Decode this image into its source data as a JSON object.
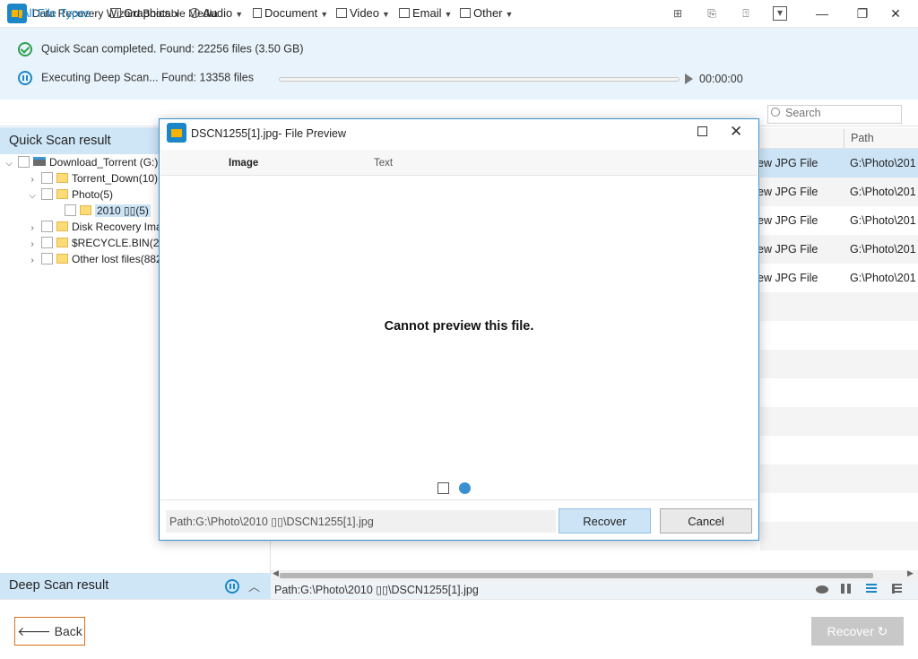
{
  "window": {
    "title": "Data Recovery Wizard Bootable Media",
    "min": "—",
    "max": "❐",
    "close": "✕",
    "icons": [
      "⊞",
      "⎘",
      "⍐",
      "▾"
    ]
  },
  "status": {
    "quick_scan": "Quick Scan completed.  Found: 22256 files (3.50 GB)",
    "deep_scan": "Executing Deep Scan... Found: 13358 files",
    "progress": 0.0,
    "timer": "00:00:00"
  },
  "filters": [
    {
      "label": "All File Types"
    },
    {
      "label": "Graphics"
    },
    {
      "label": "Audio"
    },
    {
      "label": "Document"
    },
    {
      "label": "Video"
    },
    {
      "label": "Email"
    },
    {
      "label": "Other"
    }
  ],
  "search": {
    "placeholder": "Search"
  },
  "left_panel": {
    "quick_title": "Quick Scan result",
    "tree": {
      "root": "Download_Torrent (G:)(",
      "torrent": "Torrent_Down(10)",
      "photo": "Photo(5)",
      "photo_2010": "2010 ▯▯(5)",
      "disk": "Disk Recovery Ima",
      "recycle": "$RECYCLE.BIN(20)",
      "other": "Other lost files(882"
    },
    "deep_title": "Deep Scan result"
  },
  "table": {
    "col_path": "Path",
    "rows": [
      {
        "type": "ew JPG File",
        "path": "G:\\Photo\\201"
      },
      {
        "type": "ew JPG File",
        "path": "G:\\Photo\\201"
      },
      {
        "type": "ew JPG File",
        "path": "G:\\Photo\\201"
      },
      {
        "type": "ew JPG File",
        "path": "G:\\Photo\\201"
      },
      {
        "type": "ew JPG File",
        "path": "G:\\Photo\\201"
      }
    ]
  },
  "path_bar": "Path:G:\\Photo\\2010 ▯▯\\DSCN1255[1].jpg",
  "footer": {
    "back": "Back",
    "recover": "Recover"
  },
  "dialog": {
    "title": "DSCN1255[1].jpg- File Preview",
    "tab_image": "Image",
    "tab_text": "Text",
    "message": "Cannot preview this file.",
    "path": "Path:G:\\Photo\\2010 ▯▯\\DSCN1255[1].jpg",
    "recover": "Recover",
    "cancel": "Cancel"
  }
}
